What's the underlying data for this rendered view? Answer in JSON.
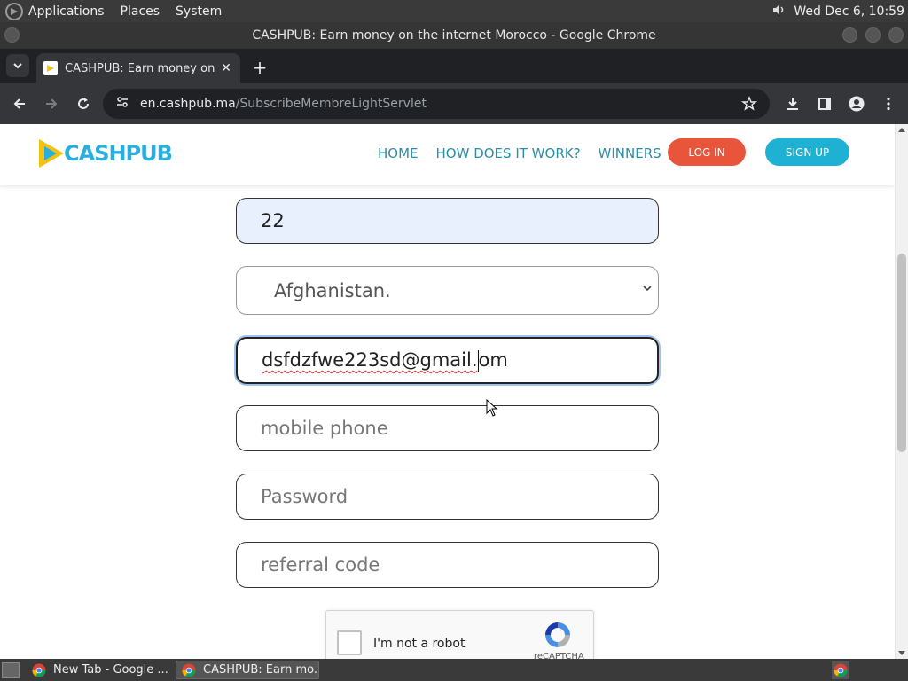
{
  "os_panel": {
    "menus": [
      "Applications",
      "Places",
      "System"
    ],
    "clock": "Wed Dec  6, 10:59"
  },
  "window": {
    "title": "CASHPUB: Earn money on the internet Morocco - Google Chrome"
  },
  "browser": {
    "tab_title": "CASHPUB: Earn money on the internet Morocco",
    "url_host": "en.cashpub.ma",
    "url_path": "/SubscribeMembreLightServlet"
  },
  "site": {
    "brand": "CASHPUB",
    "nav": [
      "HOME",
      "HOW DOES IT WORK?",
      "WINNERS"
    ],
    "login_label": "LOG IN",
    "signup_label": "SIGN UP",
    "colors": {
      "brand": "#29aee0",
      "login": "#e9553a",
      "signup": "#1fb1d4",
      "nav": "#2a8ea6"
    }
  },
  "form": {
    "age_value": "22",
    "country_selected": "Afghanistan.",
    "email_before_caret": "dsfdzfwe223sd@gmail.",
    "email_after_caret": "om",
    "mobile_placeholder": "mobile phone",
    "password_placeholder": "Password",
    "referral_placeholder": "referral code",
    "captcha_label": "I'm not a robot",
    "captcha_brand": "reCAPTCHA"
  },
  "taskbar": {
    "tasks": [
      "New Tab - Google ...",
      "CASHPUB: Earn mo..."
    ]
  }
}
